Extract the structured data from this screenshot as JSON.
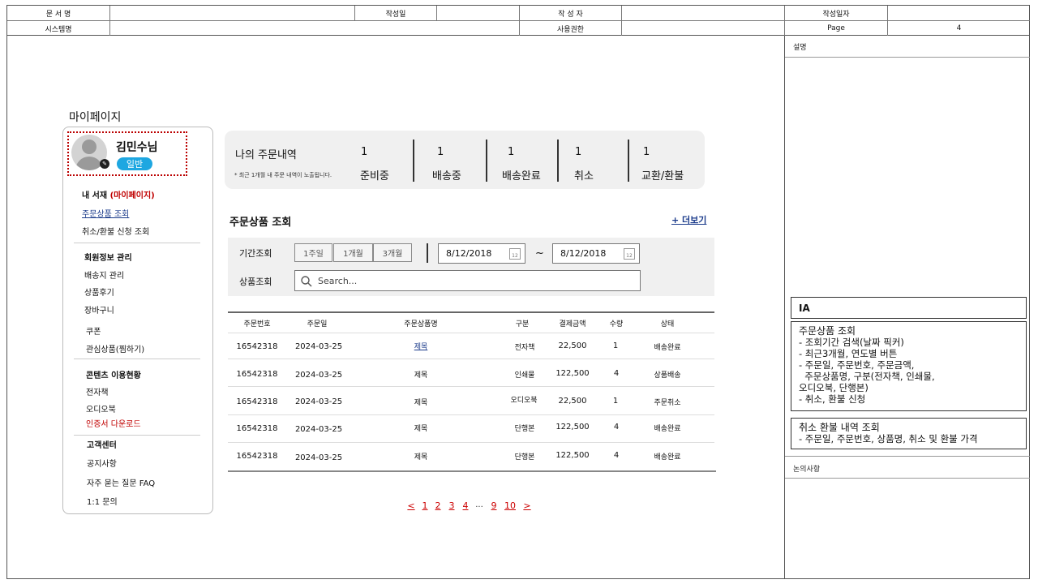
{
  "header": {
    "doc_name_label": "문 서 명",
    "author_date_label": "작성일",
    "author_label": "작 성 자",
    "write_date_label": "작성일자",
    "system_label": "시스템명",
    "permission_label": "사용권한",
    "page_label": "Page",
    "page_value": "4"
  },
  "right_panel": {
    "desc_label": "설명",
    "ia_label": "IA",
    "ia_box1": {
      "title": "주문상품 조회",
      "lines": [
        "- 조회기간 검색(날짜 픽커)",
        "- 최근3개월, 연도별 버튼",
        "- 주문일, 주문번호, 주문금액,",
        "  주문상품명, 구분(전자책, 인쇄물,",
        "오디오북, 단행본)",
        "- 취소, 환불 신청"
      ]
    },
    "ia_box2": {
      "title": "취소 환불 내역 조회",
      "lines": [
        "- 주문일, 주문번호, 상품명, 취소 및 환불 가격"
      ]
    },
    "discussion_label": "논의사항"
  },
  "page_title": "마이페이지",
  "profile": {
    "name": "김민수님",
    "grade": "일반"
  },
  "sidebar": {
    "my_shelf": "내 서재",
    "my_page_tag": "(마이페이지)",
    "items": [
      {
        "label": "주문상품 조회"
      },
      {
        "label": "취소/환불 신청 조회"
      },
      {
        "label": "회원정보 관리"
      },
      {
        "label": "배송지 관리"
      },
      {
        "label": "상품후기"
      },
      {
        "label": "장바구니"
      },
      {
        "label": "쿠폰"
      },
      {
        "label": "관심상품(찜하기)"
      },
      {
        "label": "콘텐츠 이용현황"
      },
      {
        "label": "전자책"
      },
      {
        "label": "오디오북"
      },
      {
        "label": "인증서 다운로드"
      },
      {
        "label": "고객센터"
      },
      {
        "label": "공지사항"
      },
      {
        "label": "자주 묻는 질문 FAQ"
      },
      {
        "label": "1:1 문의"
      }
    ]
  },
  "summary": {
    "title": "나의 주문내역",
    "note": "* 최근 1개월 내 주문 내역이 노출됩니다.",
    "stats": [
      {
        "count": "1",
        "label": "준비중"
      },
      {
        "count": "1",
        "label": "배송중"
      },
      {
        "count": "1",
        "label": "배송완료"
      },
      {
        "count": "1",
        "label": "취소"
      },
      {
        "count": "1",
        "label": "교환/환불"
      }
    ]
  },
  "orders": {
    "title": "주문상품 조회",
    "more": "+ 더보기",
    "filter": {
      "period_label": "기간조회",
      "period_buttons": [
        "1주일",
        "1개월",
        "3개월"
      ],
      "date_from": "8/12/2018",
      "date_to": "8/12/2018",
      "tilde": "~",
      "product_label": "상품조회",
      "search_placeholder": "Search...",
      "cal_day": "12"
    },
    "columns": [
      "주문번호",
      "주문일",
      "주문상품명",
      "구분",
      "결제금액",
      "수량",
      "상태"
    ],
    "rows": [
      {
        "no": "16542318",
        "date": "2024-03-25",
        "name": "제목",
        "type": "전자책",
        "amount": "22,500",
        "qty": "1",
        "status": "배송완료"
      },
      {
        "no": "16542318",
        "date": "2024-03-25",
        "name": "제목",
        "type": "인쇄물",
        "amount": "122,500",
        "qty": "4",
        "status": "상품배송"
      },
      {
        "no": "16542318",
        "date": "2024-03-25",
        "name": "제목",
        "type": "오디오북",
        "amount": "22,500",
        "qty": "1",
        "status": "주문취소"
      },
      {
        "no": "16542318",
        "date": "2024-03-25",
        "name": "제목",
        "type": "단행본",
        "amount": "122,500",
        "qty": "4",
        "status": "배송완료"
      },
      {
        "no": "16542318",
        "date": "2024-03-25",
        "name": "제목",
        "type": "단행본",
        "amount": "122,500",
        "qty": "4",
        "status": "배송완료"
      }
    ],
    "pagination": [
      "<",
      "1",
      "2",
      "3",
      "4",
      "...",
      "9",
      "10",
      ">"
    ]
  },
  "colors": {
    "accent_red": "#c00000",
    "grade_blue": "#1ea7e1",
    "link_blue": "#1a3a8a"
  }
}
